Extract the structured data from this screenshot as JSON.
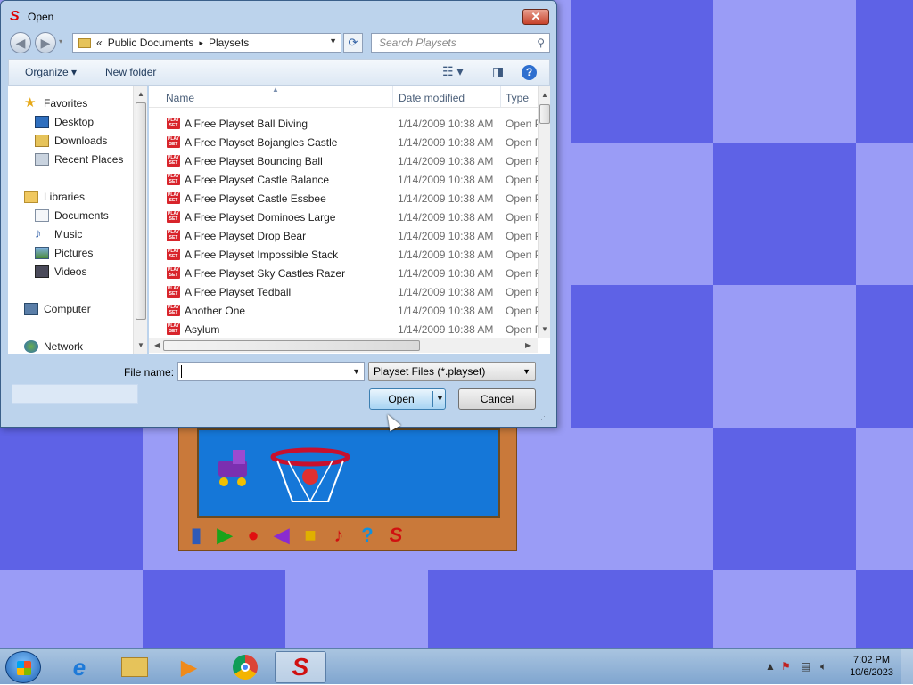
{
  "dialog": {
    "title": "Open",
    "close_label": "✕"
  },
  "navbar": {
    "back_label": "◀",
    "forward_label": "▶",
    "chevron_label": "«",
    "breadcrumb": [
      "Public Documents",
      "Playsets"
    ],
    "breadcrumb_sep": "▸",
    "search_placeholder": "Search Playsets"
  },
  "toolbar": {
    "organize_label": "Organize ▾",
    "new_folder_label": "New folder",
    "views_icon": "☷ ▾",
    "pane_icon": "◨",
    "help_label": "?"
  },
  "nav": {
    "favorites": "Favorites",
    "desktop": "Desktop",
    "downloads": "Downloads",
    "recent": "Recent Places",
    "libraries": "Libraries",
    "documents": "Documents",
    "music": "Music",
    "pictures": "Pictures",
    "videos": "Videos",
    "computer": "Computer",
    "network": "Network"
  },
  "columns": {
    "name": "Name",
    "date": "Date modified",
    "type": "Type"
  },
  "file_icon_text": "PLAY SET",
  "files": [
    {
      "name": "A Free Playset Ball Diving",
      "date": "1/14/2009 10:38 AM",
      "type": "Open P"
    },
    {
      "name": "A Free Playset Bojangles Castle",
      "date": "1/14/2009 10:38 AM",
      "type": "Open P"
    },
    {
      "name": "A Free Playset Bouncing Ball",
      "date": "1/14/2009 10:38 AM",
      "type": "Open P"
    },
    {
      "name": "A Free Playset Castle Balance",
      "date": "1/14/2009 10:38 AM",
      "type": "Open P"
    },
    {
      "name": "A Free Playset Castle Essbee",
      "date": "1/14/2009 10:38 AM",
      "type": "Open P"
    },
    {
      "name": "A Free Playset Dominoes Large",
      "date": "1/14/2009 10:38 AM",
      "type": "Open P"
    },
    {
      "name": "A Free Playset Drop Bear",
      "date": "1/14/2009 10:38 AM",
      "type": "Open P"
    },
    {
      "name": "A Free Playset Impossible Stack",
      "date": "1/14/2009 10:38 AM",
      "type": "Open P"
    },
    {
      "name": "A Free Playset Sky Castles Razer",
      "date": "1/14/2009 10:38 AM",
      "type": "Open P"
    },
    {
      "name": "A Free Playset Tedball",
      "date": "1/14/2009 10:38 AM",
      "type": "Open P"
    },
    {
      "name": "Another One",
      "date": "1/14/2009 10:38 AM",
      "type": "Open P"
    },
    {
      "name": "Asylum",
      "date": "1/14/2009 10:38 AM",
      "type": "Open P"
    }
  ],
  "bottom": {
    "file_name_label": "File name:",
    "file_name_value": "",
    "filter_value": "Playset Files (*.playset)",
    "open_label": "Open",
    "cancel_label": "Cancel"
  },
  "taskbar": {
    "time": "7:02 PM",
    "date": "10/6/2023"
  },
  "colors": {
    "desktop_light": "#9a9cf6",
    "desktop_dark": "#5e62e6",
    "accent": "#3c7fb1"
  }
}
